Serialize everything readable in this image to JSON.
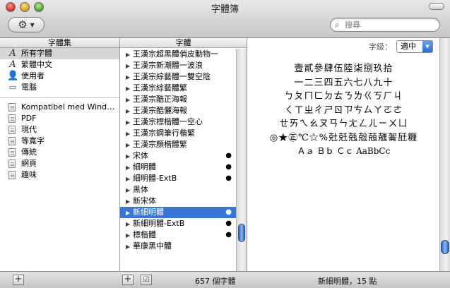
{
  "window": {
    "title": "字體簿"
  },
  "toolbar": {
    "search_placeholder": "搜尋"
  },
  "columns": {
    "collections_header": "字體集",
    "fonts_header": "字體"
  },
  "collections": {
    "system": [
      {
        "label": "所有字體",
        "icon": "font-icon",
        "selected": true
      },
      {
        "label": "繁體中文",
        "icon": "font-icon",
        "selected": false
      },
      {
        "label": "使用者",
        "icon": "user-icon",
        "selected": false
      },
      {
        "label": "電腦",
        "icon": "computer-icon",
        "selected": false
      }
    ],
    "user": [
      {
        "label": "Kompatibel med Wind…",
        "icon": "collection-doc-icon"
      },
      {
        "label": "PDF",
        "icon": "collection-doc-icon"
      },
      {
        "label": "現代",
        "icon": "collection-doc-icon"
      },
      {
        "label": "等寬字",
        "icon": "collection-doc-icon"
      },
      {
        "label": "傳統",
        "icon": "collection-doc-icon"
      },
      {
        "label": "網頁",
        "icon": "collection-doc-icon"
      },
      {
        "label": "趣味",
        "icon": "collection-doc-icon"
      }
    ]
  },
  "fonts": [
    {
      "label": "王漢宗超黑體俏皮動物一",
      "dot": false,
      "selected": false
    },
    {
      "label": "王漢宗新潮體一波浪",
      "dot": false,
      "selected": false
    },
    {
      "label": "王漢宗綜藝體一雙空陰",
      "dot": false,
      "selected": false
    },
    {
      "label": "王漢宗綜藝體繁",
      "dot": false,
      "selected": false
    },
    {
      "label": "王漢宗酷正海報",
      "dot": false,
      "selected": false
    },
    {
      "label": "王漢宗酷儷海報",
      "dot": false,
      "selected": false
    },
    {
      "label": "王漢宗標楷體一空心",
      "dot": false,
      "selected": false
    },
    {
      "label": "王漢宗鋼筆行楷繁",
      "dot": false,
      "selected": false
    },
    {
      "label": "王漢宗顏楷體繁",
      "dot": false,
      "selected": false
    },
    {
      "label": "宋体",
      "dot": true,
      "selected": false
    },
    {
      "label": "細明體",
      "dot": true,
      "selected": false
    },
    {
      "label": "細明體-ExtB",
      "dot": true,
      "selected": false
    },
    {
      "label": "黑体",
      "dot": false,
      "selected": false
    },
    {
      "label": "新宋体",
      "dot": false,
      "selected": false
    },
    {
      "label": "新細明體",
      "dot": true,
      "selected": true
    },
    {
      "label": "新細明體-ExtB",
      "dot": true,
      "selected": false
    },
    {
      "label": "標楷體",
      "dot": true,
      "selected": false
    },
    {
      "label": "華康黑中體",
      "dot": false,
      "selected": false
    }
  ],
  "preview": {
    "size_label": "字級：",
    "size_value": "適中",
    "lines": [
      "壹貳參肆伍陸柒捌玖拾",
      "一二三四五六七八九十",
      "ㄅㄆㄇㄈㄉㄊㄋㄌㄍㄎㄏㄐ",
      "ㄑㄒㄓㄔㄕㄖㄗㄘㄙㄚㄛㄜ",
      "ㄝㄞㄟㄠㄡㄢㄣㄤㄥㄦㄧㄨㄩ",
      "◎★㊣℃☆%兙兛兞兝兡兣嗧瓩糎",
      "Ａａ Ｂｂ Ｃｃ AaBbCc"
    ]
  },
  "status": {
    "font_count": "657 個字體",
    "selection_info": "新細明體，15 點"
  }
}
